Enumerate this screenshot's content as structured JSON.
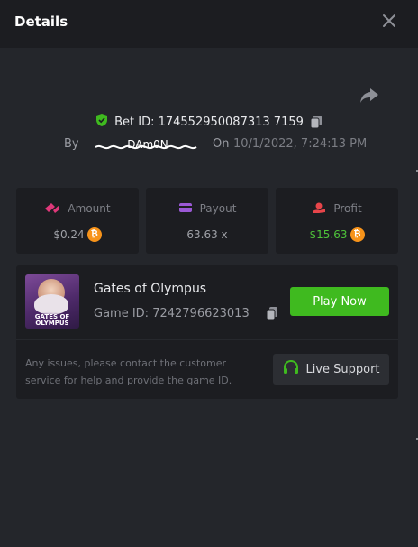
{
  "header": {
    "title": "Details"
  },
  "bet": {
    "id_text": "Bet ID: 174552950087313 7159",
    "by_label": "By",
    "username": "DAm0N",
    "on_label": "On",
    "timestamp": "10/1/2022, 7:24:13 PM"
  },
  "stats": {
    "amount": {
      "label": "Amount",
      "value": "$0.24",
      "currency_icon": "bitcoin-icon"
    },
    "payout": {
      "label": "Payout",
      "value": "63.63 x"
    },
    "profit": {
      "label": "Profit",
      "value": "$15.63",
      "currency_icon": "bitcoin-icon"
    }
  },
  "game": {
    "thumbnail_text": "GATES OF OLYMPUS",
    "name": "Gates of Olympus",
    "id_text": "Game ID: 7242796623013",
    "play_label": "Play Now"
  },
  "support": {
    "help_text": "Any issues, please contact the customer service for help and provide the game ID.",
    "button_label": "Live Support"
  },
  "colors": {
    "accent_green": "#3fba1f",
    "profit_green": "#4ec23a",
    "bitcoin": "#f7931a",
    "panel": "#1c1d21",
    "background": "#24262b"
  }
}
